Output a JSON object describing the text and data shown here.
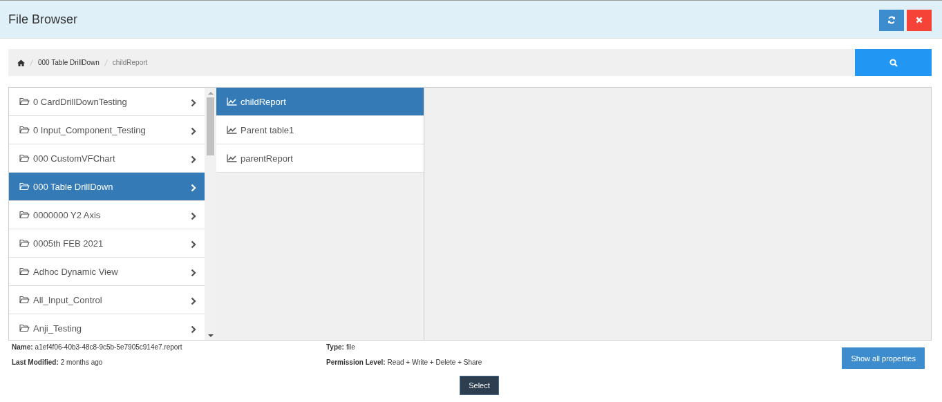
{
  "window": {
    "title": "File Browser"
  },
  "breadcrumb": [
    {
      "label": "000 Table DrillDown",
      "selected": false
    },
    {
      "label": "childReport",
      "selected": true
    }
  ],
  "folders": [
    {
      "label": "0 CardDrillDownTesting",
      "selected": false
    },
    {
      "label": "0 Input_Component_Testing",
      "selected": false
    },
    {
      "label": "000 CustomVFChart",
      "selected": false
    },
    {
      "label": "000 Table DrillDown",
      "selected": true
    },
    {
      "label": "0000000 Y2 Axis",
      "selected": false
    },
    {
      "label": "0005th FEB 2021",
      "selected": false
    },
    {
      "label": "Adhoc Dynamic View",
      "selected": false
    },
    {
      "label": "All_Input_Control",
      "selected": false
    },
    {
      "label": "Anji_Testing",
      "selected": false
    }
  ],
  "reports": [
    {
      "label": "childReport",
      "selected": true
    },
    {
      "label": "Parent table1",
      "selected": false
    },
    {
      "label": "parentReport",
      "selected": false
    }
  ],
  "details": {
    "left": [
      {
        "label": "Name:",
        "value": "a1ef4f06-40b3-48c8-9c5b-5e7905c914e7.report"
      },
      {
        "label": "Last Modified:",
        "value": "2 months ago"
      }
    ],
    "right": [
      {
        "label": "Type:",
        "value": "file"
      },
      {
        "label": "Permission Level:",
        "value": "Read + Write + Delete + Share"
      }
    ]
  },
  "show_all_button": "Show all properties",
  "select_button": "Select"
}
